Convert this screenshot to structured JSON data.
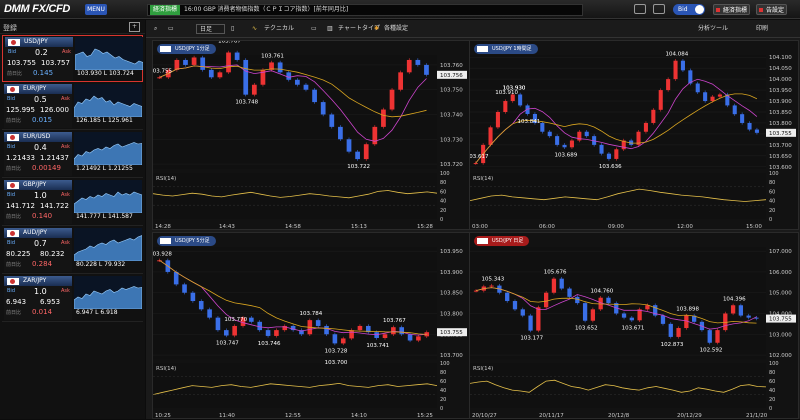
{
  "header": {
    "logo": "DMM FX/CFD",
    "menu_label": "MENU",
    "news_tag": "経済指標",
    "news_text": "16:00 GBP 消費者物価指数（ＣＰＩコア指数）[前年同月比]",
    "bid_toggle": "Bid",
    "econ_btn": "経済指標",
    "alert_btn": "告設定"
  },
  "left_tools": {
    "icon_label": "登録",
    "add_label": "+"
  },
  "pairs": [
    {
      "name": "USD/JPY",
      "spread": "0.2",
      "bid": "103.755",
      "ask": "103.757",
      "change_label": "前日比",
      "change": "0.145",
      "high": "103.930",
      "low": "L 103.724",
      "dir": "down",
      "spark": [
        0.5,
        0.55,
        0.6,
        0.45,
        0.5,
        0.7,
        0.65,
        0.55,
        0.6,
        0.5,
        0.4,
        0.45,
        0.35,
        0.3,
        0.25,
        0.2,
        0.3,
        0.25
      ]
    },
    {
      "name": "EUR/JPY",
      "spread": "0.5",
      "bid": "125.995",
      "ask": "126.000",
      "change_label": "前日比",
      "change": "0.015",
      "high": "126.185",
      "low": "L 125.961",
      "dir": "down",
      "spark": [
        0.3,
        0.5,
        0.45,
        0.6,
        0.55,
        0.7,
        0.6,
        0.65,
        0.5,
        0.55,
        0.4,
        0.5,
        0.45,
        0.4,
        0.35,
        0.45,
        0.4,
        0.35
      ]
    },
    {
      "name": "EUR/USD",
      "spread": "0.4",
      "bid": "1.21433",
      "ask": "1.21437",
      "change_label": "前日比",
      "change": "0.00149",
      "high": "1.21492",
      "low": "L 1.21255",
      "dir": "up",
      "spark": [
        0.2,
        0.35,
        0.3,
        0.45,
        0.4,
        0.5,
        0.55,
        0.5,
        0.6,
        0.55,
        0.65,
        0.7,
        0.6,
        0.65,
        0.7,
        0.75,
        0.7,
        0.72
      ]
    },
    {
      "name": "GBP/JPY",
      "spread": "1.0",
      "bid": "141.712",
      "ask": "141.722",
      "change_label": "前日比",
      "change": "0.140",
      "high": "141.777",
      "low": "L 141.587",
      "dir": "up",
      "spark": [
        0.3,
        0.4,
        0.5,
        0.45,
        0.55,
        0.5,
        0.6,
        0.55,
        0.65,
        0.6,
        0.55,
        0.7,
        0.6,
        0.65,
        0.6,
        0.7,
        0.65,
        0.6
      ]
    },
    {
      "name": "AUD/JPY",
      "spread": "0.7",
      "bid": "80.225",
      "ask": "80.232",
      "change_label": "前日比",
      "change": "0.284",
      "high": "80.228",
      "low": "L 79.932",
      "dir": "up",
      "spark": [
        0.2,
        0.3,
        0.35,
        0.4,
        0.5,
        0.45,
        0.55,
        0.6,
        0.55,
        0.65,
        0.7,
        0.6,
        0.65,
        0.7,
        0.75,
        0.7,
        0.8,
        0.85
      ]
    },
    {
      "name": "ZAR/JPY",
      "spread": "1.0",
      "bid": "6.943",
      "ask": "6.953",
      "change_label": "前日比",
      "change": "0.014",
      "high": "6.947",
      "low": "L 6.918",
      "dir": "up",
      "spark": [
        0.3,
        0.4,
        0.35,
        0.5,
        0.45,
        0.6,
        0.55,
        0.5,
        0.6,
        0.65,
        0.55,
        0.6,
        0.7,
        0.65,
        0.7,
        0.75,
        0.7,
        0.72
      ]
    }
  ],
  "chart_toolbar": {
    "period": "日足",
    "tech": "テクニカル",
    "chart_type": "チャートタイプ",
    "settings": "各種設定",
    "analysis": "分析ツール",
    "print": "印刷"
  },
  "charts": [
    {
      "title": "USD/JPY 1分足",
      "style": "blue",
      "rsi_label": "RSI(14)",
      "chart_data": {
        "type": "line",
        "title": "USD/JPY 1分足",
        "x": [
          "14:28",
          "14:43",
          "14:58",
          "15:13",
          "15:28"
        ],
        "ylabels": [
          "103.760",
          "103.750",
          "103.740",
          "103.730",
          "103.720"
        ],
        "ylim": [
          103.718,
          103.764
        ],
        "current": "103.756",
        "values": [
          103.755,
          103.758,
          103.762,
          103.76,
          103.763,
          103.758,
          103.755,
          103.757,
          103.765,
          103.762,
          103.748,
          103.752,
          103.758,
          103.761,
          103.757,
          103.754,
          103.752,
          103.75,
          103.745,
          103.74,
          103.735,
          103.73,
          103.725,
          103.722,
          103.728,
          103.735,
          103.742,
          103.75,
          103.757,
          103.762,
          103.76,
          103.756
        ],
        "annotations": [
          "103.763",
          "103.755",
          "103.767",
          "103.748",
          "103.761",
          "103.722"
        ],
        "rsi_ticks": [
          "100",
          "80",
          "60",
          "40",
          "20",
          "0"
        ],
        "rsi": [
          55,
          52,
          50,
          53,
          56,
          54,
          50,
          48,
          52,
          55,
          58,
          54,
          50,
          47,
          49,
          52,
          55,
          53,
          50,
          48,
          46,
          50,
          54,
          60,
          62,
          58,
          55,
          57,
          59,
          56
        ]
      }
    },
    {
      "title": "USD/JPY 1時間足",
      "style": "blue",
      "rsi_label": "RSI(14)",
      "chart_data": {
        "type": "line",
        "title": "USD/JPY 1時間足",
        "x": [
          "03:00",
          "06:00",
          "09:00",
          "12:00",
          "15:00"
        ],
        "ylabels": [
          "104.100",
          "104.050",
          "104.000",
          "103.950",
          "103.900",
          "103.850",
          "103.800",
          "103.750",
          "103.700",
          "103.650",
          "103.600"
        ],
        "ylim": [
          103.59,
          104.11
        ],
        "current": "103.755",
        "values": [
          103.617,
          103.7,
          103.78,
          103.85,
          103.9,
          103.93,
          103.88,
          103.841,
          103.8,
          103.76,
          103.74,
          103.7,
          103.689,
          103.72,
          103.76,
          103.74,
          103.7,
          103.66,
          103.636,
          103.68,
          103.72,
          103.7,
          103.76,
          103.8,
          103.86,
          103.95,
          104.0,
          104.084,
          104.04,
          103.98,
          103.94,
          103.9,
          103.92,
          103.93,
          103.88,
          103.84,
          103.8,
          103.77,
          103.755
        ],
        "annotations": [
          "103.617",
          "103.910",
          "103.930",
          "103.841",
          "103.689",
          "103.636",
          "104.084",
          "103.930"
        ],
        "rsi_ticks": [
          "100",
          "80",
          "60",
          "40",
          "20",
          "0"
        ],
        "rsi": [
          40,
          45,
          50,
          52,
          48,
          46,
          44,
          42,
          45,
          48,
          46,
          44,
          42,
          48,
          55,
          60,
          65,
          62,
          58,
          55,
          52,
          50,
          48,
          45,
          42,
          40,
          38,
          40,
          42
        ]
      }
    },
    {
      "title": "USD/JPY 5分足",
      "style": "blue",
      "rsi_label": "RSI(14)",
      "chart_data": {
        "type": "line",
        "title": "USD/JPY 5分足",
        "x": [
          "10:25",
          "11:40",
          "12:55",
          "14:10",
          "15:25"
        ],
        "ylabels": [
          "103.950",
          "103.900",
          "103.850",
          "103.800",
          "103.750",
          "103.700"
        ],
        "ylim": [
          103.69,
          103.96
        ],
        "current": "103.755",
        "values": [
          103.928,
          103.9,
          103.87,
          103.85,
          103.83,
          103.81,
          103.79,
          103.76,
          103.747,
          103.77,
          103.79,
          103.78,
          103.76,
          103.746,
          103.76,
          103.77,
          103.76,
          103.75,
          103.784,
          103.77,
          103.75,
          103.728,
          103.74,
          103.76,
          103.77,
          103.755,
          103.741,
          103.75,
          103.767,
          103.75,
          103.735,
          103.745,
          103.755
        ],
        "annotations": [
          "103.928",
          "103.747",
          "103.746",
          "103.784",
          "103.728",
          "103.770",
          "103.741",
          "103.767",
          "103.700"
        ],
        "rsi_ticks": [
          "100",
          "80",
          "60",
          "40",
          "20",
          "0"
        ],
        "rsi": [
          30,
          35,
          40,
          45,
          50,
          48,
          46,
          50,
          52,
          48,
          46,
          50,
          54,
          52,
          50,
          48,
          46,
          50,
          52,
          55,
          50,
          48,
          46,
          50,
          52,
          48,
          50,
          52,
          54,
          50
        ]
      }
    },
    {
      "title": "USD/JPY 日足",
      "style": "red",
      "rsi_label": "RSI(14)",
      "chart_data": {
        "type": "line",
        "title": "USD/JPY 日足",
        "x": [
          "20/10/27",
          "20/11/17",
          "20/12/8",
          "20/12/29",
          "21/1/20"
        ],
        "ylabels": [
          "107.000",
          "106.000",
          "105.000",
          "104.000",
          "103.000",
          "102.000"
        ],
        "ylim": [
          101.8,
          107.2
        ],
        "current": "103.755",
        "values": [
          105.1,
          105.3,
          105.343,
          105.0,
          104.6,
          104.2,
          103.9,
          103.177,
          104.3,
          105.0,
          105.676,
          105.2,
          104.8,
          104.5,
          103.652,
          104.2,
          104.76,
          104.5,
          104.0,
          103.8,
          103.671,
          104.2,
          104.4,
          103.9,
          103.5,
          102.873,
          103.3,
          103.898,
          103.6,
          103.2,
          102.592,
          103.2,
          104.0,
          104.396,
          103.9,
          103.8,
          103.755
        ],
        "annotations": [
          "105.343",
          "105.676",
          "103.177",
          "104.760",
          "103.652",
          "103.671",
          "102.873",
          "103.898",
          "104.396",
          "102.592"
        ],
        "rsi_ticks": [
          "100",
          "80",
          "60",
          "40",
          "20",
          "0"
        ],
        "rsi": [
          55,
          58,
          60,
          52,
          45,
          40,
          38,
          35,
          48,
          60,
          62,
          55,
          48,
          45,
          40,
          46,
          52,
          50,
          45,
          42,
          40,
          45,
          48,
          44,
          40,
          35,
          38,
          45,
          42,
          38,
          35,
          42,
          50,
          52,
          48,
          47
        ]
      }
    }
  ]
}
